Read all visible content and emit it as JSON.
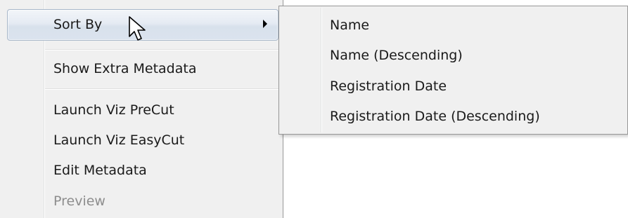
{
  "context_menu": {
    "items": [
      {
        "label": "Sort By",
        "has_submenu": true,
        "highlighted": true,
        "enabled": true
      },
      {
        "label": "Show Extra Metadata",
        "enabled": true
      },
      {
        "label": "Launch Viz PreCut",
        "enabled": true
      },
      {
        "label": "Launch Viz EasyCut",
        "enabled": true
      },
      {
        "label": "Edit Metadata",
        "enabled": true
      },
      {
        "label": "Preview",
        "enabled": false
      }
    ]
  },
  "submenu": {
    "items": [
      {
        "label": "Name"
      },
      {
        "label": "Name (Descending)"
      },
      {
        "label": "Registration Date"
      },
      {
        "label": "Registration Date (Descending)"
      }
    ]
  },
  "icons": {
    "submenu_arrow": "chevron-right-icon",
    "cursor": "mouse-pointer-icon"
  },
  "colors": {
    "menu_background": "#f0f0f0",
    "highlight_border": "#a8b7c9",
    "disabled_text": "#8d8d8d"
  }
}
